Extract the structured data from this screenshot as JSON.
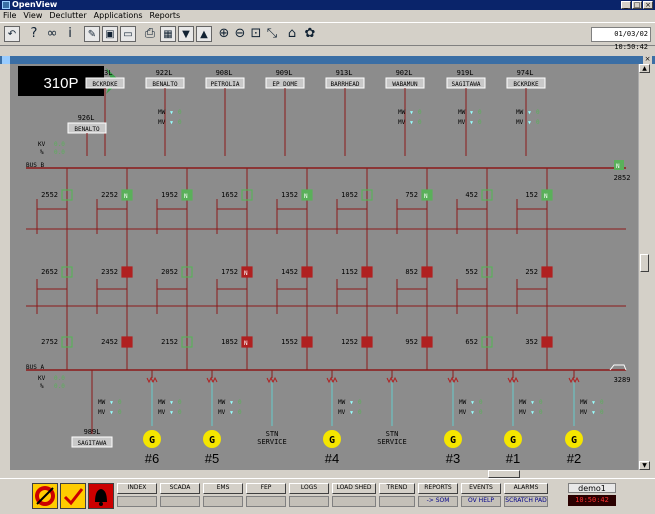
{
  "window": {
    "title": "OpenView"
  },
  "menu": [
    "File",
    "View",
    "Declutter",
    "Applications",
    "Reports"
  ],
  "toolbar": {
    "datetime": "01/03/02 10:50:42"
  },
  "station": {
    "name": "310P"
  },
  "feeders": [
    {
      "id": "973L",
      "dest": "BCKRDKE"
    },
    {
      "id": "922L",
      "dest": "BENALTO"
    },
    {
      "id": "908L",
      "dest": "PETROLIA"
    },
    {
      "id": "909L",
      "dest": "EP DOME"
    },
    {
      "id": "913L",
      "dest": "BARRHEAD"
    },
    {
      "id": "902L",
      "dest": "WABAMUN"
    },
    {
      "id": "919L",
      "dest": "SAGITAWA"
    },
    {
      "id": "974L",
      "dest": "BCKRDKE"
    }
  ],
  "feeder_926": {
    "id": "926L",
    "dest": "BENALTO"
  },
  "feeder_989": {
    "id": "989L",
    "dest": "SAGITAWA"
  },
  "readings": {
    "mw_label": "MW",
    "mv_label": "MV",
    "kv_label": "KV",
    "pct_label": "%",
    "value": "0",
    "value_dec": "0.0"
  },
  "buses": {
    "b": "BUS B",
    "a": "BUS A"
  },
  "right_breakers": {
    "top": "2852",
    "bottom": "3289"
  },
  "breakers_row1": [
    "2552",
    "2252",
    "1952",
    "1652",
    "1352",
    "1052",
    "752",
    "452",
    "152"
  ],
  "breakers_row2": [
    "2652",
    "2352",
    "2052",
    "1752",
    "1452",
    "1152",
    "852",
    "552",
    "252"
  ],
  "breakers_row3": [
    "2752",
    "2452",
    "2152",
    "1852",
    "1552",
    "1252",
    "952",
    "652",
    "352"
  ],
  "gen_symbol": "G",
  "generators": [
    "#6",
    "#5",
    "#4",
    "#3",
    "#1",
    "#2"
  ],
  "stn_service": [
    "STN",
    "SERVICE"
  ],
  "n_flag": "N",
  "bottom_nav": {
    "top": [
      "INDEX",
      "SCADA",
      "EMS",
      "FEP",
      "LOGS",
      "LOAD SHED",
      "TREND",
      "REPORTS",
      "EVENTS",
      "ALARMS"
    ],
    "sub": [
      "-> SOM",
      "OV HELP",
      "SCRATCH PAD"
    ],
    "host": "demo1",
    "clock": "10:50:42"
  },
  "colors": {
    "bus": "#8b1a1a",
    "closed": "#b02020",
    "open": "#5ab05a",
    "gen": "#f5e600",
    "line": "#66cccc"
  }
}
